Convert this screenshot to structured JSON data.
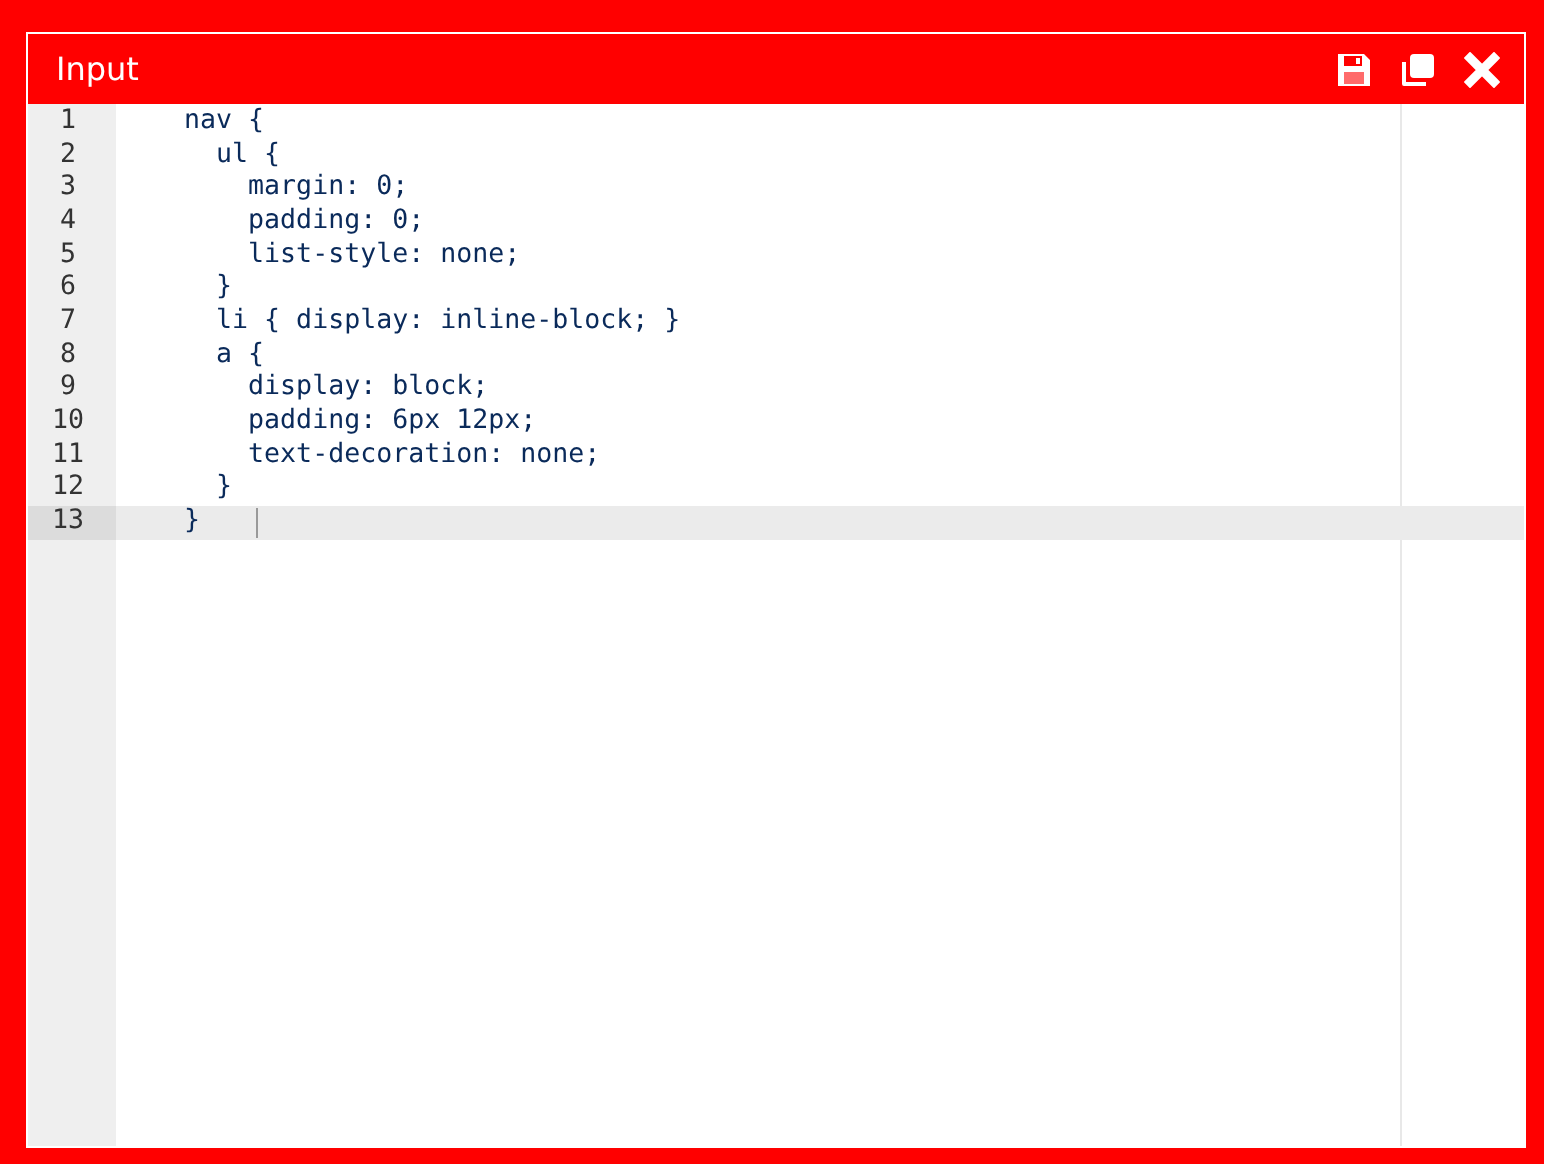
{
  "window": {
    "title": "Input"
  },
  "toolbar": [
    {
      "kind": "save"
    },
    {
      "kind": "copy"
    },
    {
      "kind": "close"
    }
  ],
  "editor": {
    "lines": [
      {
        "number": "1",
        "text": "    nav {",
        "active": false
      },
      {
        "number": "2",
        "text": "      ul {",
        "active": false
      },
      {
        "number": "3",
        "text": "        margin: 0;",
        "active": false
      },
      {
        "number": "4",
        "text": "        padding: 0;",
        "active": false
      },
      {
        "number": "5",
        "text": "        list-style: none;",
        "active": false
      },
      {
        "number": "6",
        "text": "      }",
        "active": false
      },
      {
        "number": "7",
        "text": "      li { display: inline-block; }",
        "active": false
      },
      {
        "number": "8",
        "text": "      a {",
        "active": false
      },
      {
        "number": "9",
        "text": "        display: block;",
        "active": false
      },
      {
        "number": "10",
        "text": "        padding: 6px 12px;",
        "active": false
      },
      {
        "number": "11",
        "text": "        text-decoration: none;",
        "active": false
      },
      {
        "number": "12",
        "text": "      }",
        "active": false
      },
      {
        "number": "13",
        "text": "    }",
        "active": true
      }
    ]
  }
}
